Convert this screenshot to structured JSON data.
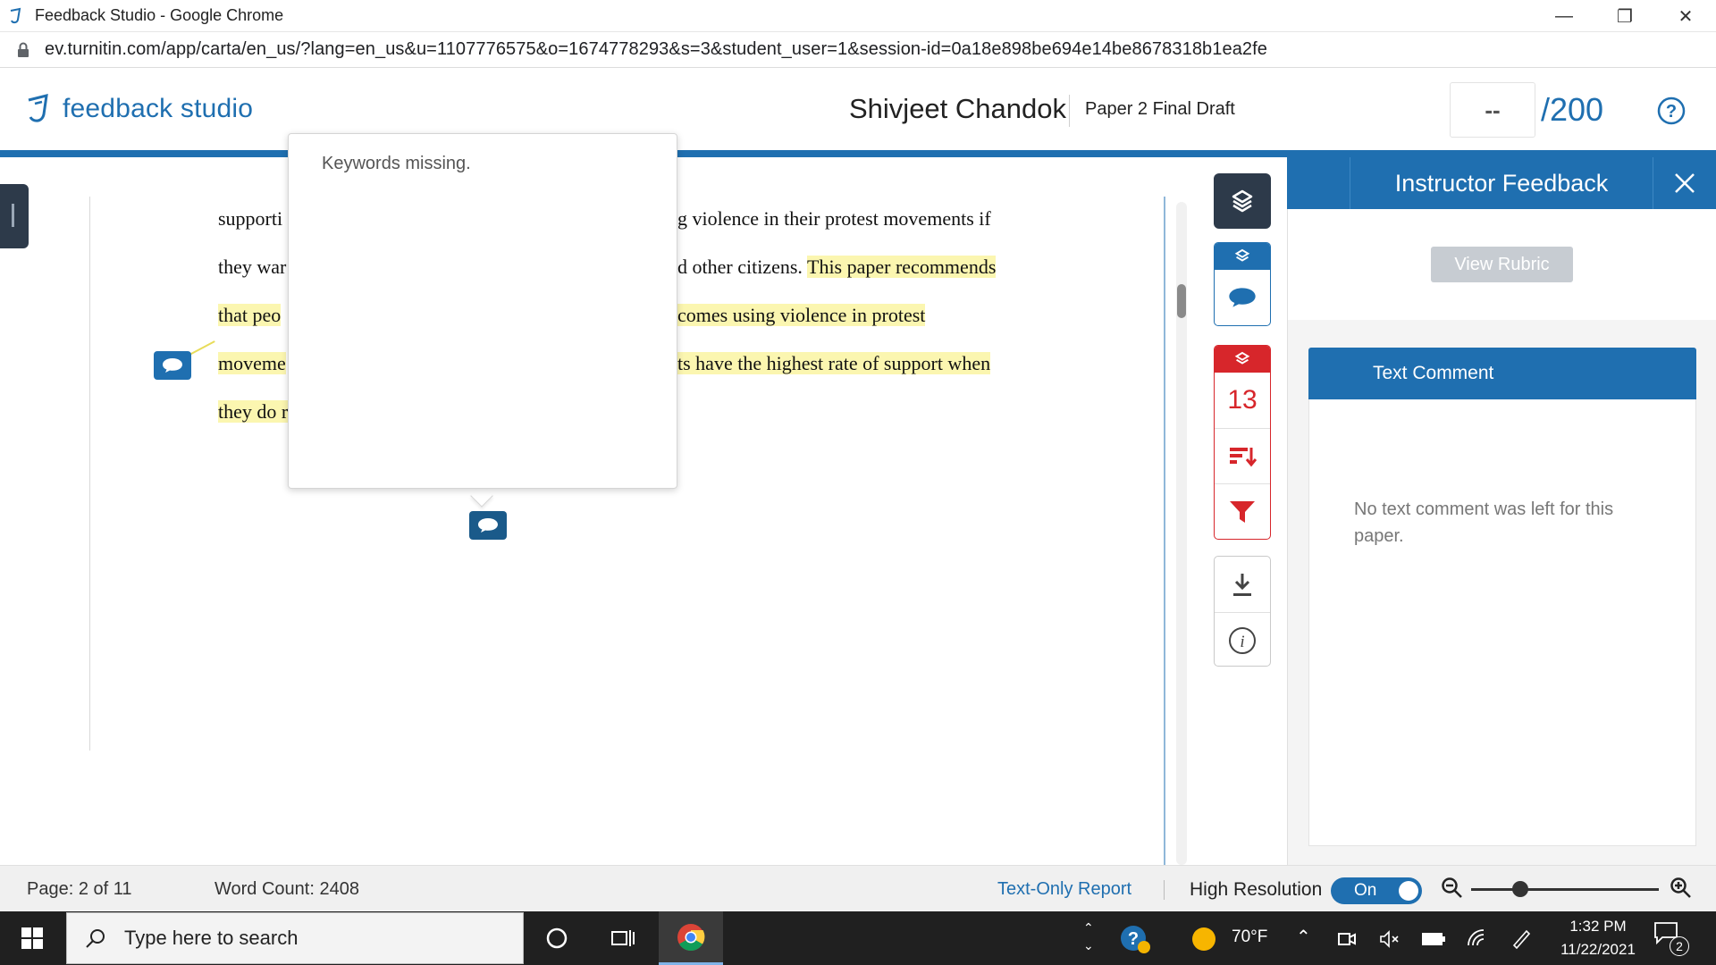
{
  "browser": {
    "window_title": "Feedback Studio - Google Chrome",
    "url": "ev.turnitin.com/app/carta/en_us/?lang=en_us&u=1107776575&o=1674778293&s=3&student_user=1&session-id=0a18e898be694e14be8678318b1ea2fe"
  },
  "header": {
    "logo_text": "feedback studio",
    "student_name": "Shivjeet Chandok",
    "paper_title": "Paper 2 Final Draft",
    "grade_value": "--",
    "grade_total": "/200"
  },
  "document": {
    "lines": [
      {
        "left": "supporti",
        "right": "g violence in their protest movements if",
        "right_hl": ""
      },
      {
        "left": "they war",
        "right": "d other citizens. ",
        "right_hl": "This paper recommends"
      },
      {
        "left": "that peo",
        "right": "",
        "right_hl": "comes using violence in protest"
      },
      {
        "left": "moveme",
        "right": "",
        "right_hl": "ts have the highest rate of support when"
      },
      {
        "left": "they do r",
        "right": "",
        "right_hl": ""
      }
    ]
  },
  "popup": {
    "message": "Keywords missing."
  },
  "toolbar": {
    "flag_count": "13"
  },
  "panel": {
    "title": "Instructor Feedback",
    "rubric_button": "View Rubric",
    "text_comment_title": "Text Comment",
    "text_comment_empty": "No text comment was left for this paper."
  },
  "statusbar": {
    "page": "Page: 2 of 11",
    "word_count": "Word Count: 2408",
    "text_only": "Text-Only Report",
    "high_res": "High Resolution",
    "toggle_state": "On"
  },
  "taskbar": {
    "search_placeholder": "Type here to search",
    "weather": "70°F",
    "time": "1:32 PM",
    "date": "11/22/2021",
    "notif_count": "2"
  },
  "colors": {
    "brand_blue": "#1f6fb0",
    "highlight": "#fbf6b0",
    "flag_red": "#d7262b",
    "toolbar_dark": "#2d3a4a"
  }
}
